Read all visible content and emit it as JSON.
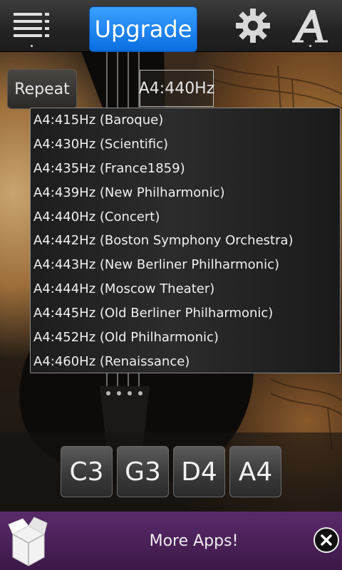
{
  "header": {
    "upgrade_label": "Upgrade",
    "menu_icon": "menu-list-icon",
    "settings_icon": "gear-icon",
    "font_icon": "font-a-icon"
  },
  "controls": {
    "repeat_label": "Repeat",
    "pitch_selected": "A4:440Hz"
  },
  "pitch_options": [
    "A4:415Hz (Baroque)",
    "A4:430Hz (Scientific)",
    "A4:435Hz (France1859)",
    "A4:439Hz (New Philharmonic)",
    "A4:440Hz (Concert)",
    "A4:442Hz (Boston Symphony Orchestra)",
    "A4:443Hz (New Berliner Philharmonic)",
    "A4:444Hz (Moscow Theater)",
    "A4:445Hz (Old Berliner Philharmonic)",
    "A4:452Hz (Old Philharmonic)",
    "A4:460Hz (Renaissance)"
  ],
  "notes": [
    "C3",
    "G3",
    "D4",
    "A4"
  ],
  "banner": {
    "text": "More Apps!",
    "close_icon": "close-icon"
  }
}
